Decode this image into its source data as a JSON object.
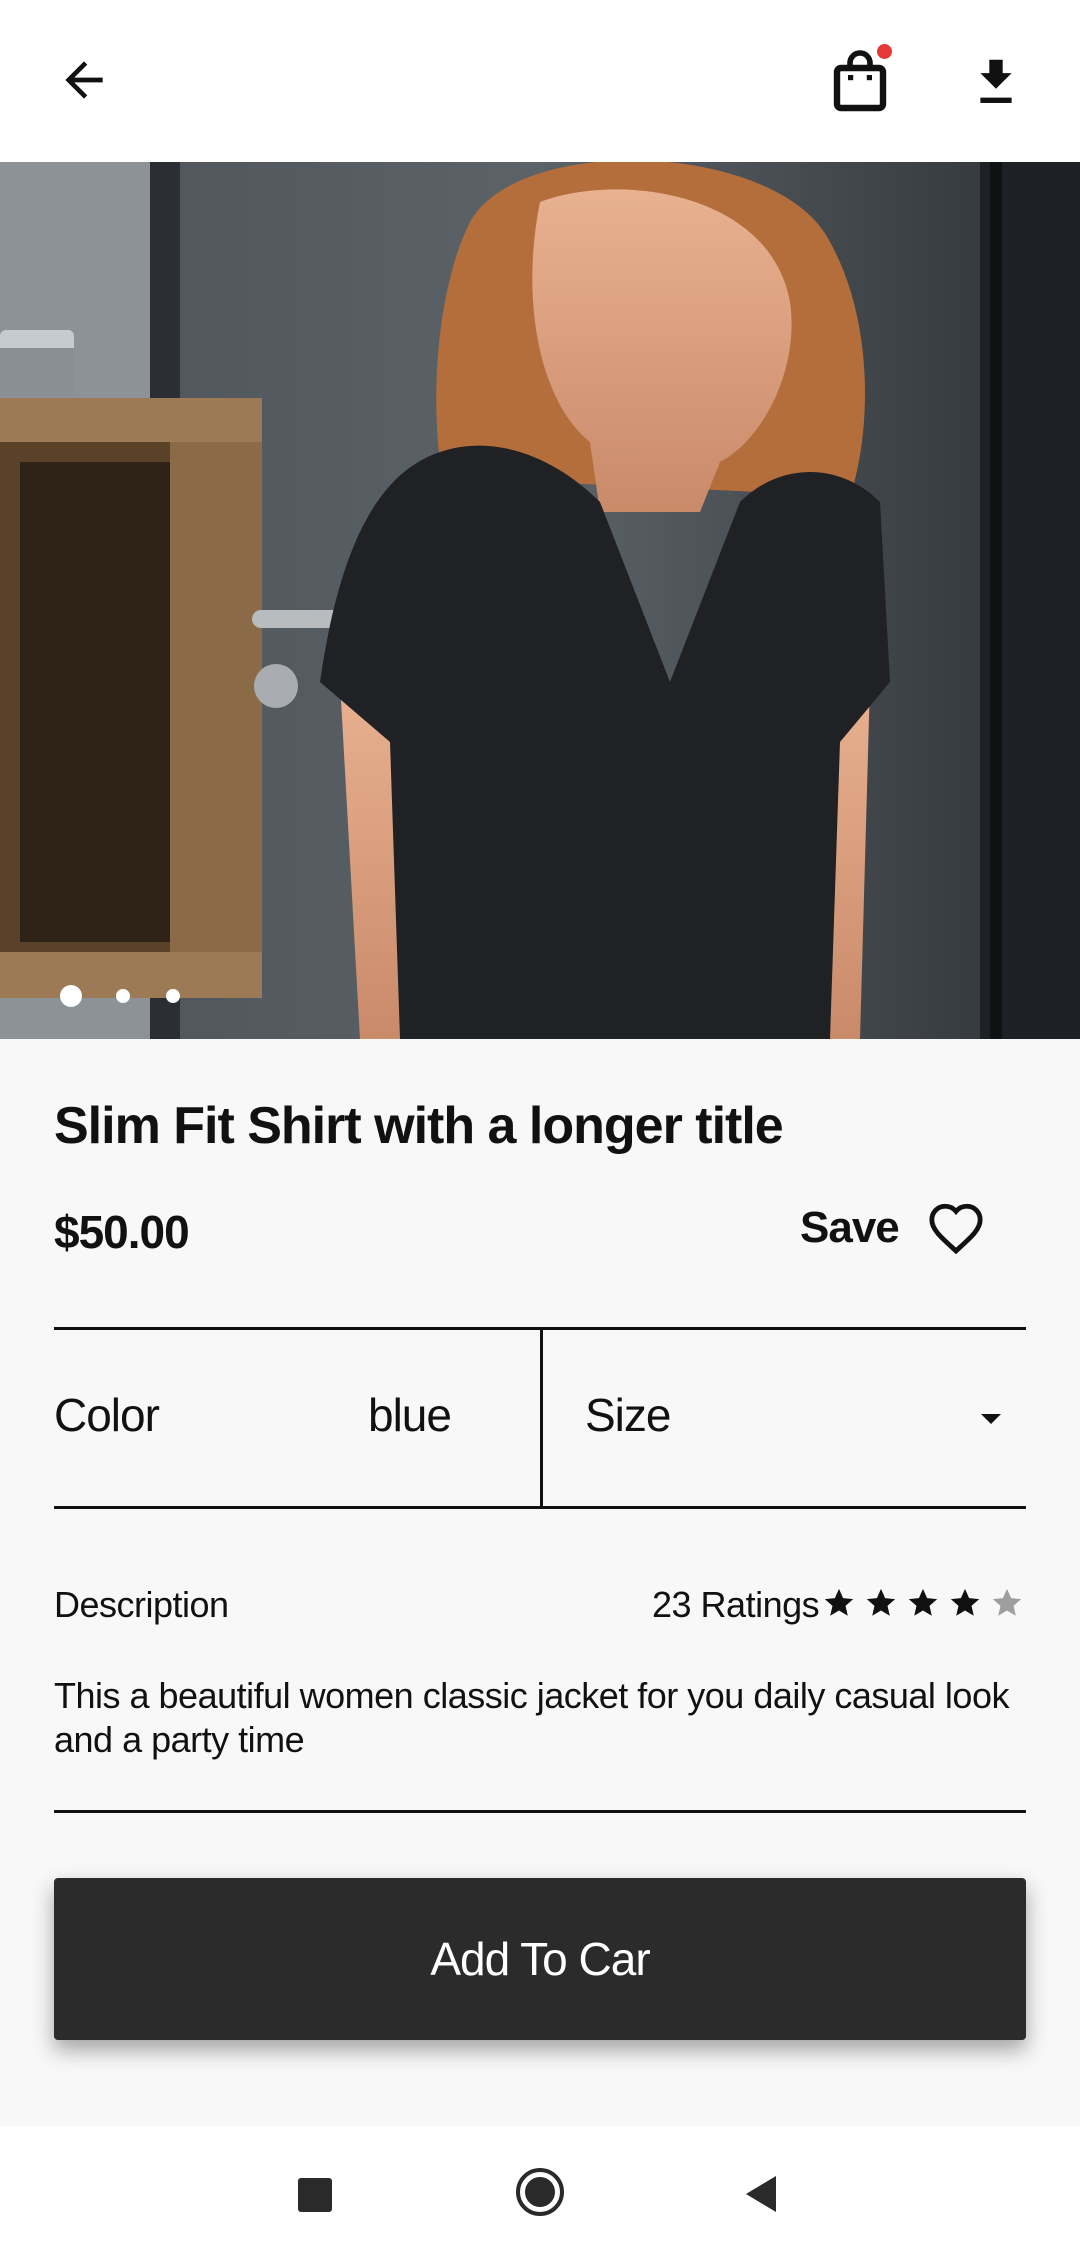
{
  "header": {
    "back_icon": "arrow-left-icon",
    "bag_icon": "shopping-bag-icon",
    "download_icon": "download-icon",
    "notification_color": "#e53935"
  },
  "product": {
    "title": "Slim Fit Shirt with a longer title",
    "price": "$50.00",
    "save_label": "Save",
    "image_count": 3,
    "active_image_index": 0
  },
  "options": {
    "color_label": "Color",
    "color_value": "blue",
    "size_label": "Size"
  },
  "details": {
    "description_label": "Description",
    "ratings_text": "23 Ratings",
    "rating_value": 4,
    "rating_max": 5,
    "description_text": "This a beautiful women classic jacket for you daily casual look and a party time"
  },
  "cta": {
    "label": "Add To Car"
  }
}
